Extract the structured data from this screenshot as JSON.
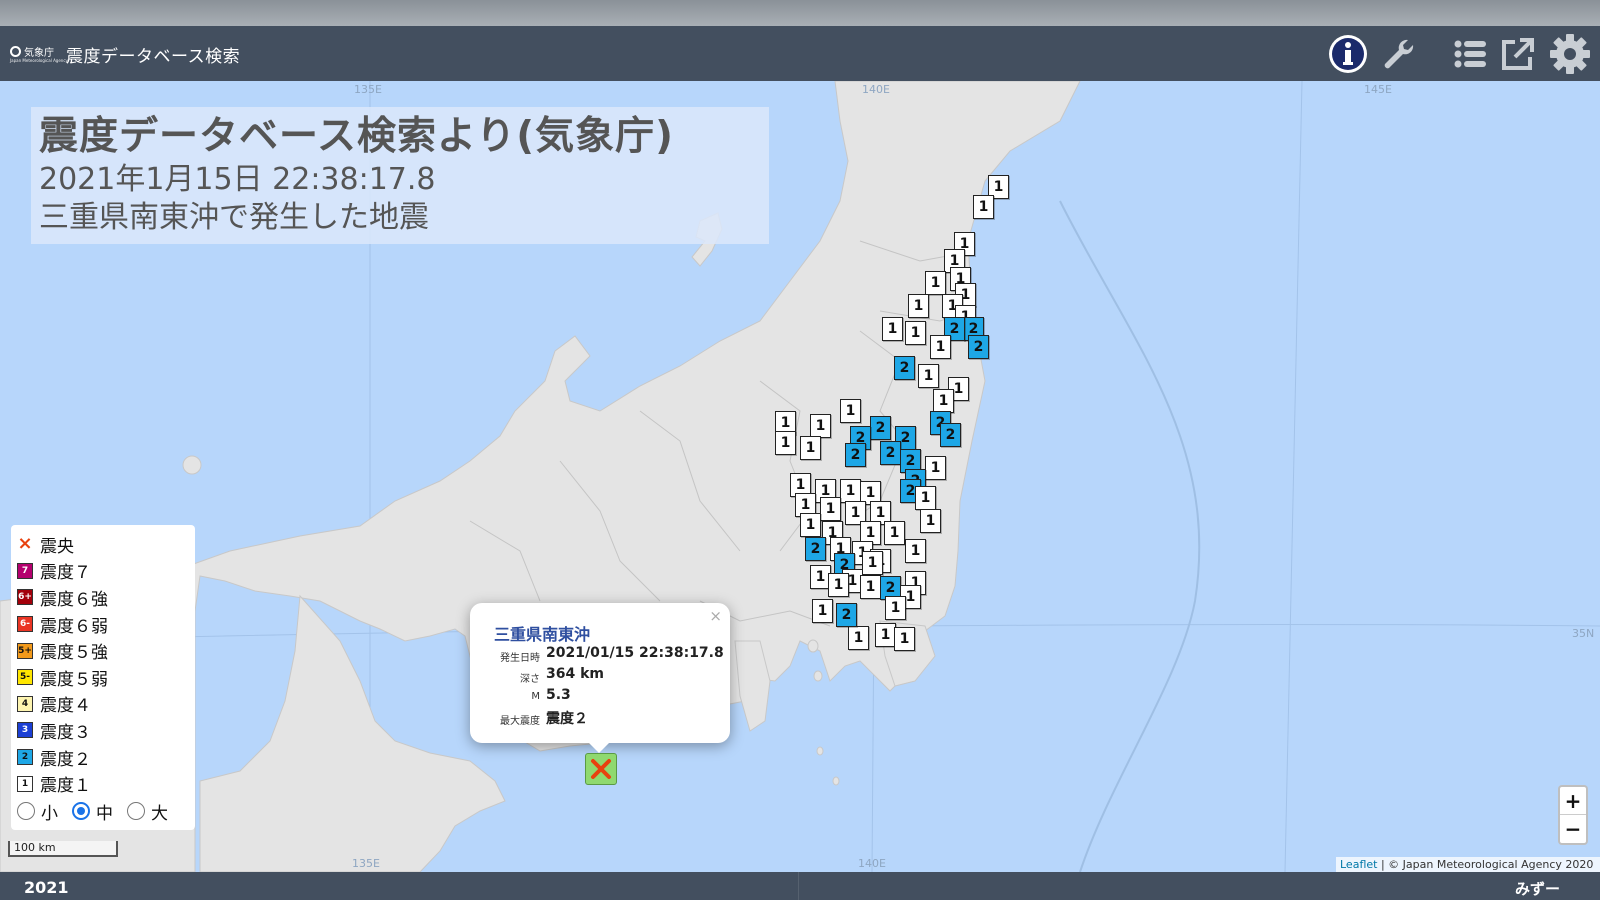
{
  "header": {
    "logo_text": "気象庁",
    "logo_subtext": "Japan Meteorological Agency",
    "title": "震度データベース検索",
    "buttons": [
      {
        "name": "info-icon"
      },
      {
        "name": "wrench-icon"
      },
      {
        "name": "list-icon"
      },
      {
        "name": "external-link-icon"
      },
      {
        "name": "gear-icon"
      }
    ]
  },
  "map": {
    "graticule": {
      "lon_top": [
        "135E",
        "140E",
        "145E"
      ],
      "lon_bottom": [
        "135E",
        "140E"
      ],
      "lat_right": "35N"
    },
    "overlay": {
      "title": "震度データベース検索より(気象庁)",
      "datetime": "2021年1月15日 22:38:17.8",
      "description": "三重県南東沖で発生した地震"
    },
    "popup": {
      "title": "三重県南東沖",
      "close_label": "×",
      "rows": [
        {
          "key": "発生日時",
          "value": "2021/01/15 22:38:17.8"
        },
        {
          "key": "深さ",
          "value": "364 km"
        },
        {
          "key": "M",
          "value": "5.3"
        },
        {
          "key": "最大震度",
          "value": "震度２"
        }
      ]
    },
    "legend": {
      "items": [
        {
          "icon": "×",
          "label": "震央",
          "color": "#e8420f",
          "border": "none"
        },
        {
          "icon": "7",
          "label": "震度７",
          "color": "#b4006e",
          "text": "#fff"
        },
        {
          "icon": "6+",
          "label": "震度６強",
          "color": "#a3000a",
          "text": "#fff"
        },
        {
          "icon": "6-",
          "label": "震度６弱",
          "color": "#ea3524",
          "text": "#fff"
        },
        {
          "icon": "5+",
          "label": "震度５強",
          "color": "#f39a1b",
          "text": "#111"
        },
        {
          "icon": "5-",
          "label": "震度５弱",
          "color": "#ffe600",
          "text": "#111"
        },
        {
          "icon": "4",
          "label": "震度４",
          "color": "#fdf4b0",
          "text": "#111"
        },
        {
          "icon": "3",
          "label": "震度３",
          "color": "#1b3fd4",
          "text": "#fff"
        },
        {
          "icon": "2",
          "label": "震度２",
          "color": "#1ea7e6",
          "text": "#111"
        },
        {
          "icon": "1",
          "label": "震度１",
          "color": "#ffffff",
          "text": "#111"
        }
      ],
      "sizes": [
        {
          "label": "小",
          "selected": false
        },
        {
          "label": "中",
          "selected": true
        },
        {
          "label": "大",
          "selected": false
        }
      ]
    },
    "scale_label": "100 km",
    "zoom": {
      "in": "+",
      "out": "−"
    },
    "attribution": {
      "leaflet": "Leaflet",
      "rest": " | © Japan Meteorological Agency 2020"
    }
  },
  "footer": {
    "year": "2021",
    "user": "みずー"
  },
  "colors": {
    "header": "#434f5f",
    "sea": "#b7d6fb",
    "land": "#e6e6e6",
    "intensity2": "#1ea7e6"
  }
}
